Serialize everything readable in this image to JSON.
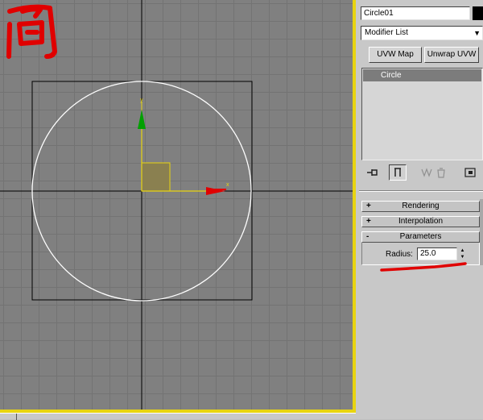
{
  "viewport": {
    "object_name": "Circle01",
    "annotation_text": "圆"
  },
  "command_panel": {
    "name_value": "Circle01",
    "color_swatch": "#000000",
    "modifier_list": {
      "selected": "Modifier List",
      "arrow_icon": "dropdown-arrow"
    },
    "buttons": {
      "uvw_map": "UVW Map",
      "unwrap_uvw": "Unwrap UVW"
    },
    "stack": {
      "items": [
        "Circle"
      ]
    },
    "stack_toolbar": {
      "pin_icon": "pin-stack-icon",
      "show_end_icon": "show-end-result-icon",
      "make_unique_icon": "make-unique-icon",
      "remove_modifier_icon": "remove-modifier-icon",
      "configure_icon": "configure-modifier-sets-icon"
    },
    "rollouts": [
      {
        "sign": "+",
        "label": "Rendering"
      },
      {
        "sign": "+",
        "label": "Interpolation"
      },
      {
        "sign": "-",
        "label": "Parameters"
      }
    ],
    "parameters": {
      "radius_label": "Radius:",
      "radius_value": "25.0"
    }
  },
  "colors": {
    "viewport_bg": "#808080",
    "active_border": "#e8d410",
    "gizmo_y": "#00a000",
    "gizmo_x": "#e00000",
    "annotation": "#e00000"
  }
}
